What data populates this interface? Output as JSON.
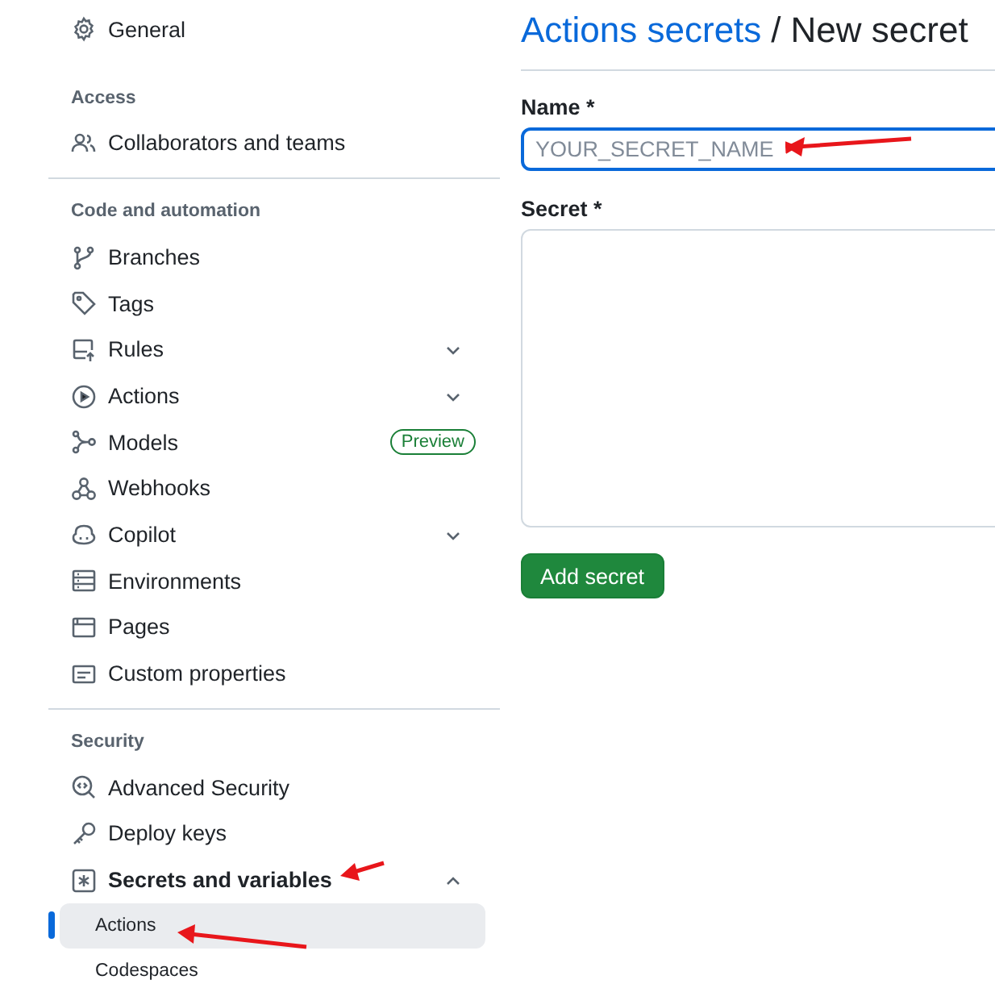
{
  "sidebar": {
    "groups": [
      {
        "divider_above": false,
        "items": [
          {
            "label": "General",
            "selected": false
          }
        ]
      },
      {
        "heading": "Access",
        "divider_above": false,
        "items": [
          {
            "label": "Collaborators and teams",
            "selected": false
          }
        ]
      },
      {
        "heading": "Code and automation",
        "divider_above": true,
        "items": [
          {
            "label": "Branches",
            "selected": false
          },
          {
            "label": "Tags",
            "selected": false
          },
          {
            "label": "Rules",
            "selected": false,
            "expanded": false
          },
          {
            "label": "Actions",
            "selected": false,
            "expanded": false
          },
          {
            "label": "Models",
            "selected": false,
            "badge": "Preview"
          },
          {
            "label": "Webhooks",
            "selected": false
          },
          {
            "label": "Copilot",
            "selected": false,
            "expanded": false
          },
          {
            "label": "Environments",
            "selected": false
          },
          {
            "label": "Pages",
            "selected": false
          },
          {
            "label": "Custom properties",
            "selected": false
          }
        ]
      },
      {
        "heading": "Security",
        "divider_above": true,
        "items": [
          {
            "label": "Advanced Security",
            "selected": false
          },
          {
            "label": "Deploy keys",
            "selected": false
          },
          {
            "label": "Secrets and variables",
            "selected": false,
            "expanded": true,
            "children": [
              {
                "label": "Actions",
                "selected": true
              },
              {
                "label": "Codespaces",
                "selected": false
              }
            ]
          }
        ]
      }
    ]
  },
  "main": {
    "breadcrumb_link": "Actions secrets",
    "separator": "/",
    "title": "New secret",
    "name_field": {
      "label": "Name *",
      "placeholder": "YOUR_SECRET_NAME",
      "focused": true
    },
    "secret_field": {
      "label": "Secret *"
    },
    "submit_button": "Add secret"
  }
}
